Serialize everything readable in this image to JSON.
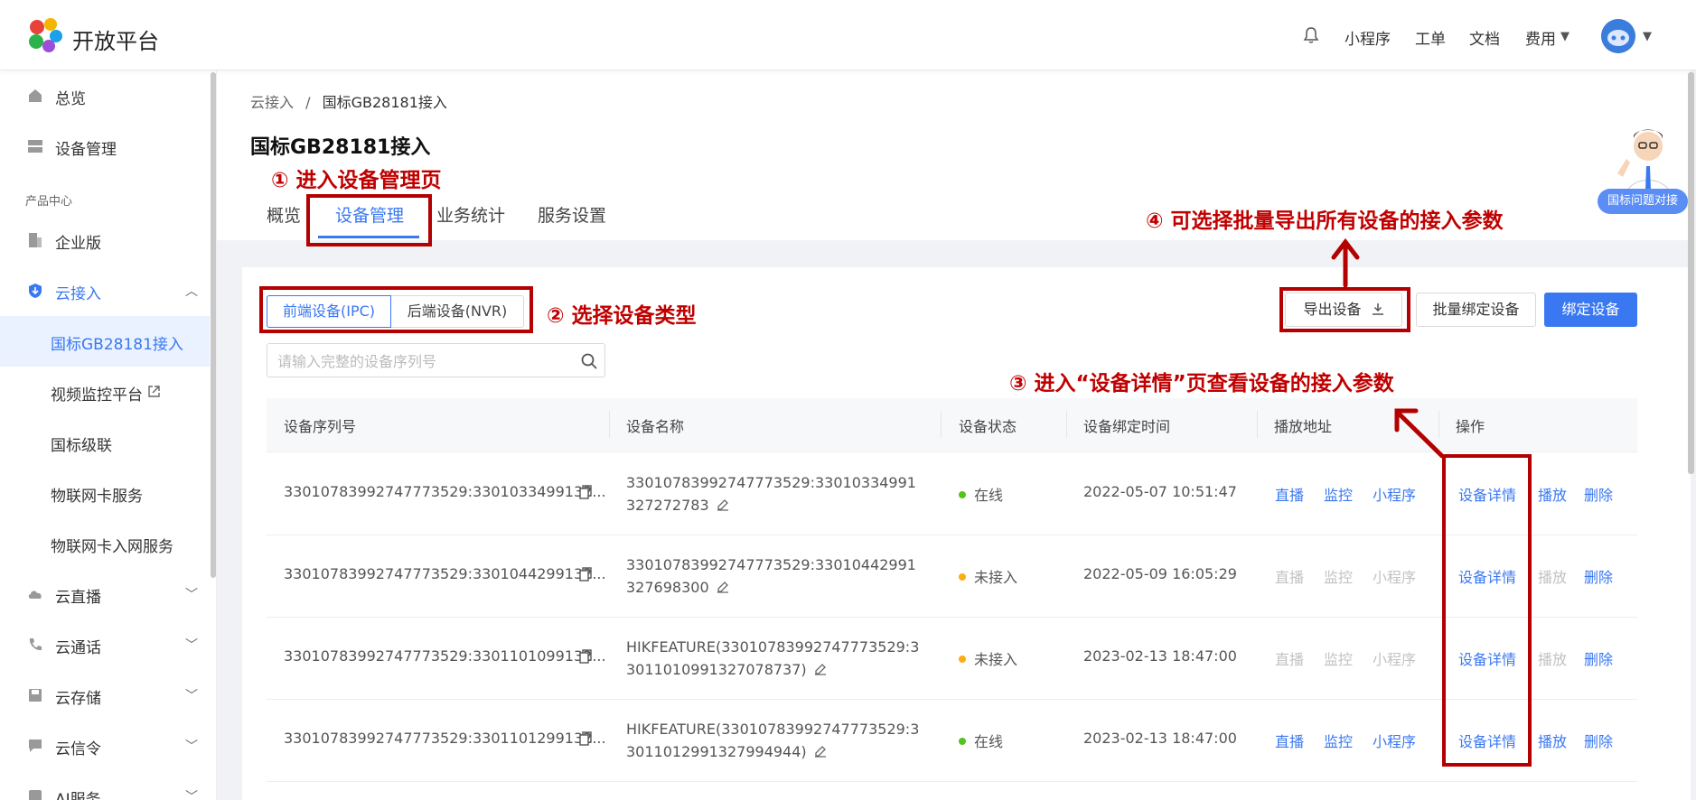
{
  "brand": "开放平台",
  "topnav": {
    "mini": "小程序",
    "ticket": "工单",
    "docs": "文档",
    "fee": "费用"
  },
  "sidebar": {
    "items": [
      {
        "label": "总览"
      },
      {
        "label": "设备管理"
      },
      {
        "label": "产品中心"
      },
      {
        "label": "企业版"
      },
      {
        "label": "云接入"
      },
      {
        "label": "国标GB28181接入"
      },
      {
        "label": "视频监控平台"
      },
      {
        "label": "国标级联"
      },
      {
        "label": "物联网卡服务"
      },
      {
        "label": "物联网卡入网服务"
      },
      {
        "label": "云直播"
      },
      {
        "label": "云通话"
      },
      {
        "label": "云存储"
      },
      {
        "label": "云信令"
      },
      {
        "label": "AI服务"
      }
    ]
  },
  "breadcrumb": {
    "parent": "云接入",
    "sep": "/",
    "current": "国标GB28181接入"
  },
  "page_title": "国标GB28181接入",
  "tabs": [
    "概览",
    "设备管理",
    "业务统计",
    "服务设置"
  ],
  "device_type": {
    "ipc": "前端设备(IPC)",
    "nvr": "后端设备(NVR)"
  },
  "search": {
    "placeholder": "请输入完整的设备序列号"
  },
  "buttons": {
    "export": "导出设备",
    "bulk_bind": "批量绑定设备",
    "bind": "绑定设备"
  },
  "table": {
    "headers": [
      "设备序列号",
      "设备名称",
      "设备状态",
      "设备绑定时间",
      "播放地址",
      "操作"
    ],
    "rows": [
      {
        "serial": "33010783992747773529:3301033499132...",
        "name": "33010783992747773529:33010334991327272783",
        "status": "在线",
        "status_color": "#52c41a",
        "time": "2022-05-07 10:51:47",
        "live": "直播",
        "monitor": "监控",
        "mini": "小程序",
        "detail": "设备详情",
        "play": "播放",
        "delete": "删除",
        "enabled": true
      },
      {
        "serial": "33010783992747773529:3301044299132...",
        "name": "33010783992747773529:33010442991327698300",
        "status": "未接入",
        "status_color": "#faad14",
        "time": "2022-05-09 16:05:29",
        "live": "直播",
        "monitor": "监控",
        "mini": "小程序",
        "detail": "设备详情",
        "play": "播放",
        "delete": "删除",
        "enabled": false
      },
      {
        "serial": "33010783992747773529:3301101099132...",
        "name": "HIKFEATURE(33010783992747773529:33011010991327078737)",
        "status": "未接入",
        "status_color": "#faad14",
        "time": "2023-02-13 18:47:00",
        "live": "直播",
        "monitor": "监控",
        "mini": "小程序",
        "detail": "设备详情",
        "play": "播放",
        "delete": "删除",
        "enabled": false
      },
      {
        "serial": "33010783992747773529:3301101299132...",
        "name": "HIKFEATURE(33010783992747773529:33011012991327994944)",
        "status": "在线",
        "status_color": "#52c41a",
        "time": "2023-02-13 18:47:00",
        "live": "直播",
        "monitor": "监控",
        "mini": "小程序",
        "detail": "设备详情",
        "play": "播放",
        "delete": "删除",
        "enabled": true
      }
    ]
  },
  "annotations": {
    "a1": "① 进入设备管理页",
    "a2": "② 选择设备类型",
    "a3": "③ 进入“设备详情”页查看设备的接入参数",
    "a4": "④ 可选择批量导出所有设备的接入参数"
  },
  "helper_badge": "国标问题对接",
  "colors": {
    "accent": "#3a78f2",
    "annotation": "#c00000",
    "online": "#52c41a",
    "offline": "#faad14"
  }
}
